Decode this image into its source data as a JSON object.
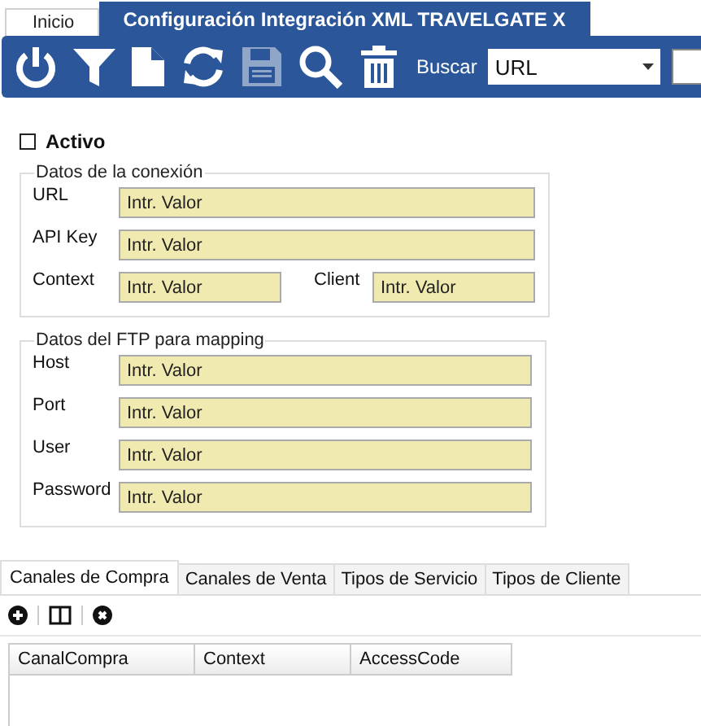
{
  "tabs": [
    {
      "label": "Inicio",
      "selected": false
    },
    {
      "label": "Configuración Integración XML TRAVELGATE X",
      "selected": true
    }
  ],
  "toolbar": {
    "icons": [
      {
        "kind": "power",
        "disabled": false
      },
      {
        "kind": "filter",
        "disabled": false
      },
      {
        "kind": "new",
        "disabled": false
      },
      {
        "kind": "refresh",
        "disabled": false
      },
      {
        "kind": "save",
        "disabled": true
      },
      {
        "kind": "search",
        "disabled": false
      },
      {
        "kind": "delete",
        "disabled": false
      }
    ],
    "search_label": "Buscar",
    "search_field": {
      "value": "URL"
    }
  },
  "active": {
    "label": "Activo",
    "checked": false
  },
  "groups": [
    {
      "title": "Datos de la conexión",
      "rows": [
        [
          {
            "label": "URL",
            "placeholder": "Intr. Valor"
          }
        ],
        [
          {
            "label": "API Key",
            "placeholder": "Intr. Valor"
          }
        ],
        [
          {
            "label": "Context",
            "placeholder": "Intr. Valor"
          },
          {
            "label": "Client",
            "placeholder": "Intr. Valor"
          }
        ]
      ]
    },
    {
      "title": "Datos del FTP para mapping",
      "rows": [
        [
          {
            "label": "Host",
            "placeholder": "Intr. Valor"
          }
        ],
        [
          {
            "label": "Port",
            "placeholder": "Intr. Valor"
          }
        ],
        [
          {
            "label": "User",
            "placeholder": "Intr. Valor"
          }
        ],
        [
          {
            "label": "Password",
            "placeholder": "Intr. Valor"
          }
        ]
      ]
    }
  ],
  "bottom_tabs": [
    {
      "label": "Canales de Compra",
      "selected": true
    },
    {
      "label": "Canales de Venta",
      "selected": false
    },
    {
      "label": "Tipos de Servicio",
      "selected": false
    },
    {
      "label": "Tipos de Cliente",
      "selected": false
    }
  ],
  "grid_tools": [
    {
      "kind": "add"
    },
    {
      "kind": "columns"
    },
    {
      "kind": "remove"
    }
  ],
  "table": {
    "columns": [
      "CanalCompra",
      "Context",
      "AccessCode"
    ]
  }
}
